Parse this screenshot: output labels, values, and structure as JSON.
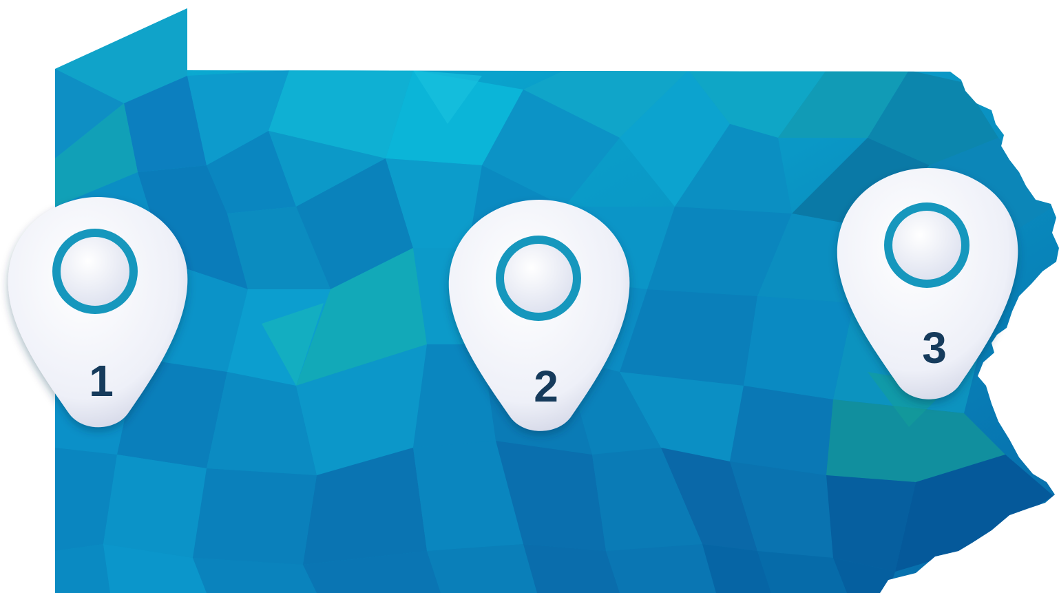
{
  "map": {
    "region": "pennsylvania-state-outline",
    "style": "low-poly-teal-blue",
    "colors": {
      "light_teal": "#0cb4d6",
      "mid_blue": "#0a93c2",
      "deep_blue": "#0666a6",
      "green_teal": "#13a6a0",
      "pin_body": "#f3f4fb",
      "pin_ring": "#1597bd",
      "pin_number": "#123b5c"
    }
  },
  "pins": [
    {
      "label": "1"
    },
    {
      "label": "2"
    },
    {
      "label": "3"
    }
  ]
}
